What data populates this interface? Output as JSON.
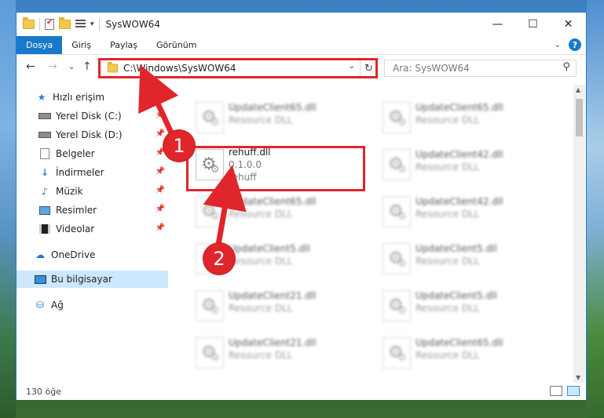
{
  "window": {
    "title": "SysWOW64",
    "controls": {
      "minimize": "—",
      "maximize": "☐",
      "close": "✕"
    }
  },
  "ribbon": {
    "tabs": [
      {
        "label": "Dosya",
        "active": true
      },
      {
        "label": "Giriş"
      },
      {
        "label": "Paylaş"
      },
      {
        "label": "Görünüm"
      }
    ],
    "help": "?",
    "expand": "⌄"
  },
  "nav": {
    "back": "←",
    "forward": "→",
    "recent": "⌄",
    "up": "↑",
    "address": "C:\\Windows\\SysWOW64",
    "address_dropdown": "⌄",
    "refresh": "↻",
    "search_placeholder": "Ara: SysWOW64",
    "search_icon": "⚲"
  },
  "sidebar": {
    "items": [
      {
        "label": "Hızlı erişim",
        "icon": "star-icon"
      },
      {
        "label": "Yerel Disk (C:)",
        "icon": "drive-icon",
        "pinned": true
      },
      {
        "label": "Yerel Disk (D:)",
        "icon": "drive-icon",
        "pinned": true
      },
      {
        "label": "Belgeler",
        "icon": "document-icon",
        "pinned": true
      },
      {
        "label": "İndirmeler",
        "icon": "download-icon",
        "pinned": true
      },
      {
        "label": "Müzik",
        "icon": "music-icon",
        "pinned": true
      },
      {
        "label": "Resimler",
        "icon": "pictures-icon",
        "pinned": true
      },
      {
        "label": "Videolar",
        "icon": "video-icon",
        "pinned": true
      },
      {
        "label": "OneDrive",
        "icon": "cloud-icon"
      },
      {
        "label": "Bu bilgisayar",
        "icon": "computer-icon",
        "selected": true
      },
      {
        "label": "Ağ",
        "icon": "network-icon"
      }
    ],
    "pin_glyph": "📌"
  },
  "files": {
    "col1": [
      {
        "name": "UpdateClient65.dll",
        "sub": "Resource DLL"
      },
      {
        "name": "rehuff.dll",
        "sub": "0.1.0.0",
        "sub2": "rehuff"
      },
      {
        "name": "UpdateClient65.dll",
        "sub": "Resource DLL"
      },
      {
        "name": "UpdateClient5.dll",
        "sub": "Resource DLL"
      },
      {
        "name": "UpdateClient21.dll",
        "sub": "Resource DLL"
      },
      {
        "name": "UpdateClient21.dll",
        "sub": "Resource DLL"
      }
    ],
    "col2": [
      {
        "name": "UpdateClient65.dll",
        "sub": "Resource DLL"
      },
      {
        "name": "UpdateClient42.dll",
        "sub": "Resource DLL"
      },
      {
        "name": "UpdateClient42.dll",
        "sub": "Resource DLL"
      },
      {
        "name": "UpdateClient5.dll",
        "sub": "Resource DLL"
      },
      {
        "name": "UpdateClient5.dll",
        "sub": "Resource DLL"
      },
      {
        "name": "UpdateClient65.dll",
        "sub": "Resource DLL"
      }
    ]
  },
  "status": {
    "count": "130 öğe"
  },
  "callouts": {
    "one": "1",
    "two": "2",
    "color": "#e0262b"
  }
}
